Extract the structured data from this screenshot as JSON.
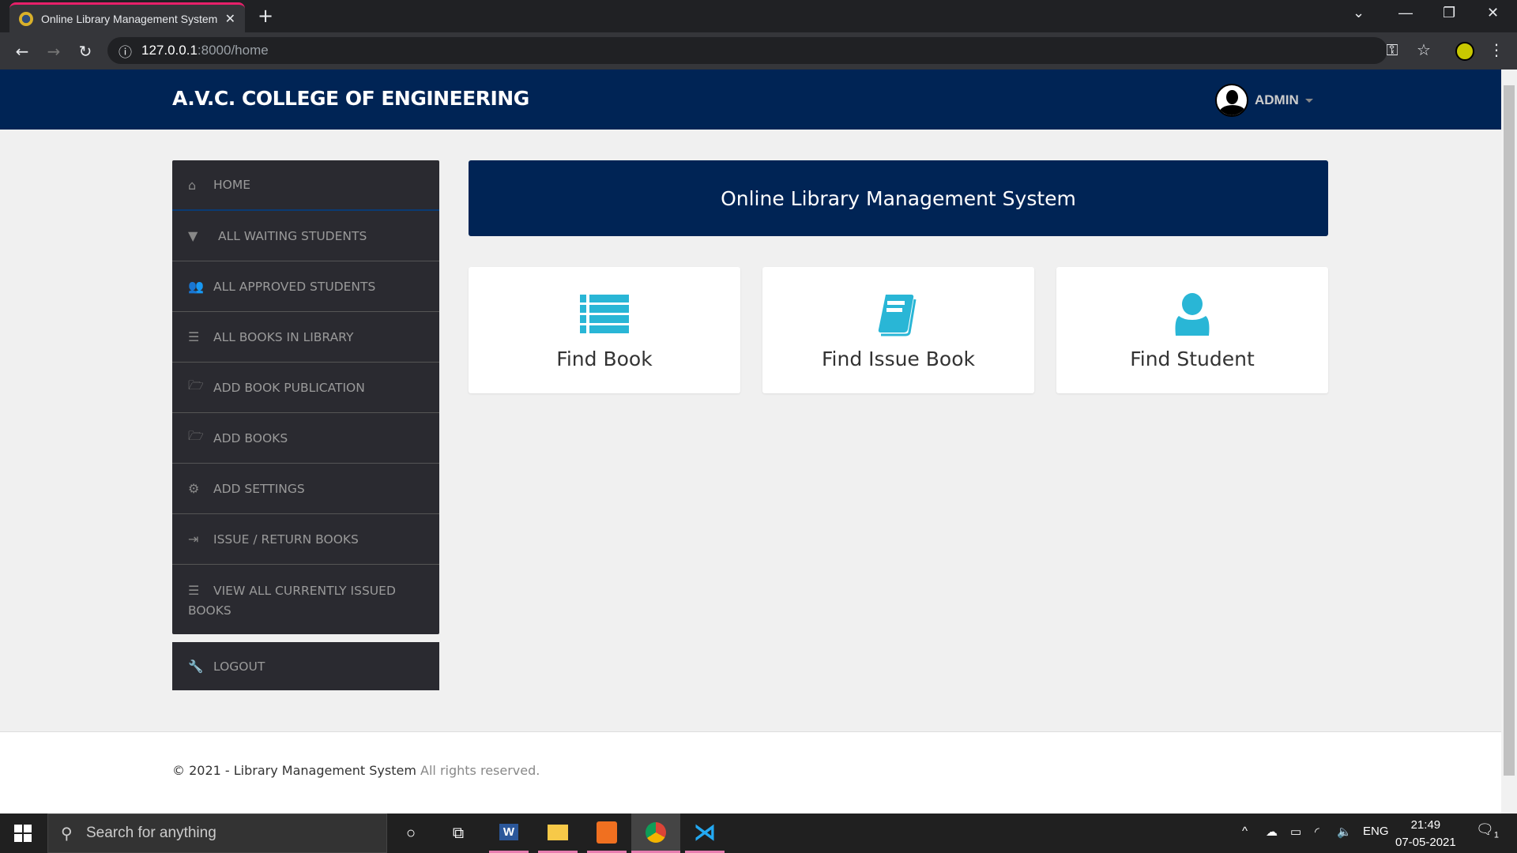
{
  "browser": {
    "tab_title": "Online Library Management System",
    "url_host": "127.0.0.1",
    "url_path": ":8000/home"
  },
  "navbar": {
    "brand": "A.V.C. COLLEGE OF ENGINEERING",
    "user": "ADMIN"
  },
  "sidebar": {
    "items": [
      {
        "icon": "home-icon",
        "glyph": "⌂",
        "label": "HOME"
      },
      {
        "icon": "filter-icon",
        "glyph": "▼",
        "label": "ALL WAITING STUDENTS"
      },
      {
        "icon": "users-icon",
        "glyph": "👥",
        "label": "ALL APPROVED STUDENTS"
      },
      {
        "icon": "list-icon",
        "glyph": "☰",
        "label": "ALL BOOKS IN LIBRARY"
      },
      {
        "icon": "folder-open-icon",
        "glyph": "🗁",
        "label": "ADD BOOK PUBLICATION"
      },
      {
        "icon": "folder-open-icon",
        "glyph": "🗁",
        "label": "ADD BOOKS"
      },
      {
        "icon": "gear-icon",
        "glyph": "⚙",
        "label": "ADD SETTINGS"
      },
      {
        "icon": "sign-out-icon",
        "glyph": "⇥",
        "label": "ISSUE / RETURN BOOKS"
      },
      {
        "icon": "list-icon",
        "glyph": "☰",
        "label": "VIEW ALL CURRENTLY ISSUED BOOKS"
      }
    ],
    "logout": {
      "icon": "wrench-icon",
      "glyph": "🔧",
      "label": "LOGOUT"
    }
  },
  "main": {
    "title": "Online Library Management System",
    "cards": [
      {
        "icon": "list-icon",
        "label": "Find Book"
      },
      {
        "icon": "book-icon",
        "label": "Find Issue Book"
      },
      {
        "icon": "user-icon",
        "label": "Find Student"
      }
    ]
  },
  "footer": {
    "copyright": "© 2021 - Library Management System",
    "rights": "All rights reserved."
  },
  "taskbar": {
    "search_placeholder": "Search for anything",
    "lang": "ENG",
    "time": "21:49",
    "date": "07-05-2021",
    "notifications": "1"
  },
  "colors": {
    "navbar": "#002455",
    "sidebar": "#2a2a30",
    "accent": "#29b6d6"
  }
}
